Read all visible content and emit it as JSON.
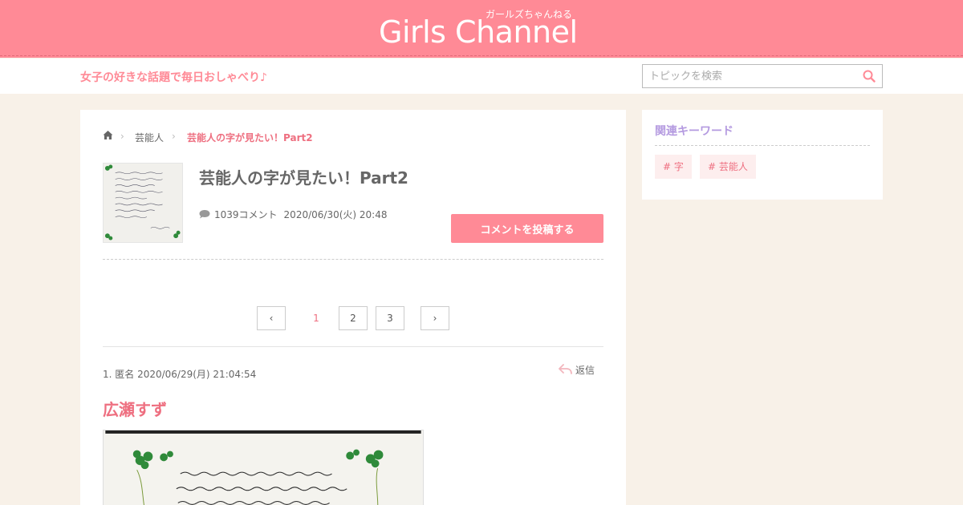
{
  "header": {
    "logo": "Girls Channel",
    "logo_sub": "ガールズちゃんねる",
    "tagline": "女子の好きな話題で毎日おしゃべり♪",
    "search_placeholder": "トピックを検索",
    "accent_color": "#ff8a96",
    "background_color": "#f8f1e8"
  },
  "breadcrumb": {
    "home_icon": "home-icon",
    "category": "芸能人",
    "current": "芸能人の字が見たい！Part2"
  },
  "topic": {
    "title": "芸能人の字が見たい！Part2",
    "comment_count": "1039コメント",
    "date": "2020/06/30(火) 20:48",
    "post_button": "コメントを投稿する"
  },
  "pagination": {
    "prev": "‹",
    "pages": [
      "1",
      "2",
      "3"
    ],
    "current": "1",
    "next": "›"
  },
  "comment": {
    "header": "1. 匿名 2020/06/29(月) 21:04:54",
    "reply": "返信",
    "text": "広瀬すず"
  },
  "sidebar": {
    "title": "関連キーワード",
    "title_color": "#b49ae0",
    "keywords": [
      "# 字",
      "# 芸能人"
    ]
  }
}
